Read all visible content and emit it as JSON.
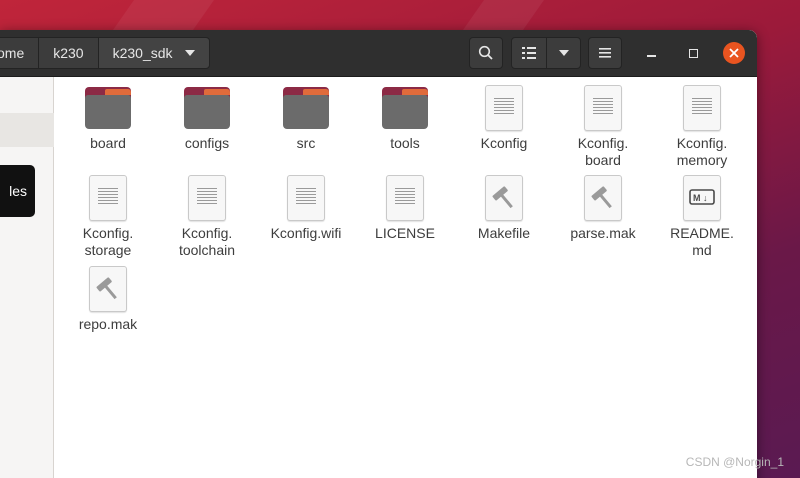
{
  "breadcrumbs": [
    "ome",
    "k230",
    "k230_sdk"
  ],
  "sidebar": {
    "tooltip": "les"
  },
  "files": [
    {
      "name": "board",
      "type": "folder"
    },
    {
      "name": "configs",
      "type": "folder"
    },
    {
      "name": "src",
      "type": "folder"
    },
    {
      "name": "tools",
      "type": "folder"
    },
    {
      "name": "Kconfig",
      "type": "text"
    },
    {
      "name": "Kconfig.\nboard",
      "type": "text"
    },
    {
      "name": "Kconfig.\nmemory",
      "type": "text"
    },
    {
      "name": "Kconfig.\nstorage",
      "type": "text"
    },
    {
      "name": "Kconfig.\ntoolchain",
      "type": "text"
    },
    {
      "name": "Kconfig.wifi",
      "type": "text"
    },
    {
      "name": "LICENSE",
      "type": "text"
    },
    {
      "name": "Makefile",
      "type": "make"
    },
    {
      "name": "parse.mak",
      "type": "make"
    },
    {
      "name": "README.\nmd",
      "type": "markdown"
    },
    {
      "name": "repo.mak",
      "type": "make"
    }
  ],
  "colors": {
    "folder_back": "#8c2a45",
    "folder_front": "#6b6b6b",
    "close_button": "#e95420",
    "headerbar": "#2f2f2f"
  },
  "watermark": "CSDN @Norgin_1"
}
